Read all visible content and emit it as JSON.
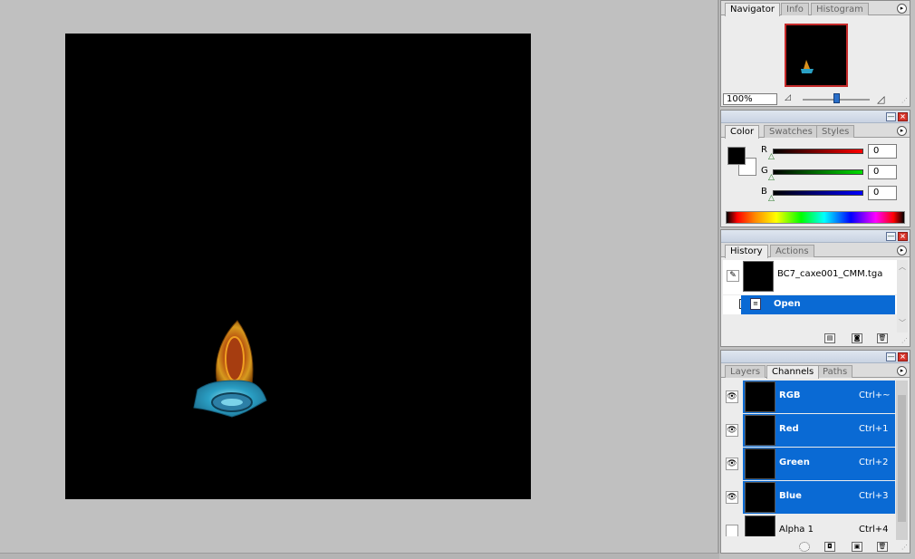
{
  "navigator": {
    "tabs": [
      "Navigator",
      "Info",
      "Histogram"
    ],
    "zoom": "100%"
  },
  "color": {
    "tabs": [
      "Color",
      "Swatches",
      "Styles"
    ],
    "r_label": "R",
    "g_label": "G",
    "b_label": "B",
    "r_value": "0",
    "g_value": "0",
    "b_value": "0"
  },
  "history": {
    "tabs": [
      "History",
      "Actions"
    ],
    "snapshot_name": "BC7_caxe001_CMM.tga",
    "step": "Open"
  },
  "channels": {
    "tabs": [
      "Layers",
      "Channels",
      "Paths"
    ],
    "rows": [
      {
        "name": "RGB",
        "shortcut": "Ctrl+~"
      },
      {
        "name": "Red",
        "shortcut": "Ctrl+1"
      },
      {
        "name": "Green",
        "shortcut": "Ctrl+2"
      },
      {
        "name": "Blue",
        "shortcut": "Ctrl+3"
      },
      {
        "name": "Alpha 1",
        "shortcut": "Ctrl+4"
      }
    ]
  },
  "colors": {
    "selection": "#0a6ad4",
    "canvas": "#000000",
    "workspace": "#c0c0c0"
  }
}
